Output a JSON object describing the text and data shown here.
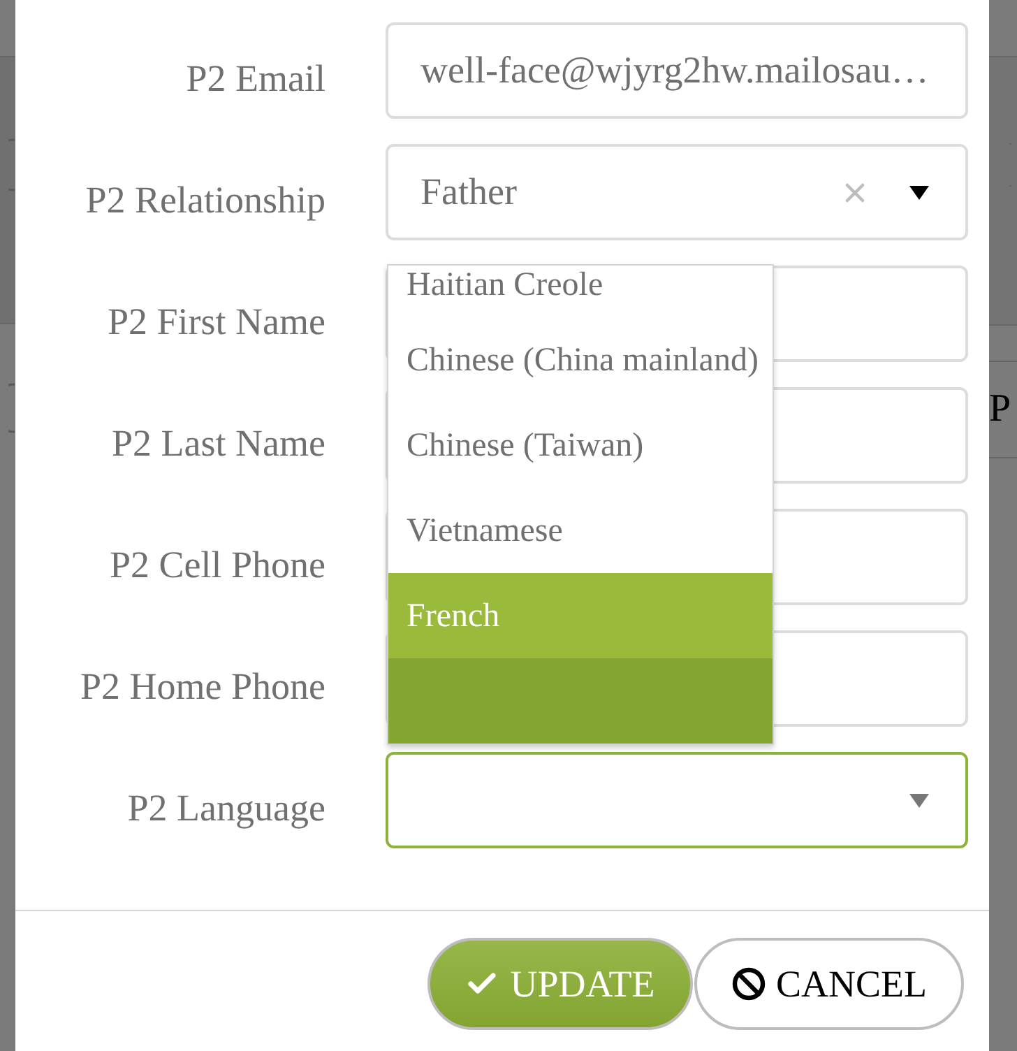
{
  "backdrop": {
    "edge_text": "P"
  },
  "form": {
    "fields": [
      {
        "label": "P2 Email",
        "kind": "text",
        "value": "well-face@wjyrg2hw.mailosau…",
        "focused": false
      },
      {
        "label": "P2 Relationship",
        "kind": "select",
        "value": "Father",
        "clearable": true,
        "open": false,
        "focused": false
      },
      {
        "label": "P2 First Name",
        "kind": "text",
        "focused": false
      },
      {
        "label": "P2 Last Name",
        "kind": "text",
        "focused": false
      },
      {
        "label": "P2 Cell Phone",
        "kind": "text",
        "focused": false
      },
      {
        "label": "P2 Home Phone",
        "kind": "text",
        "focused": false
      },
      {
        "label": "P2 Language",
        "kind": "select",
        "clearable": false,
        "open": true,
        "focused": true,
        "options": [
          {
            "label": "Haitian Creole",
            "selected": false,
            "hovered": false
          },
          {
            "label": "Chinese (China mainland)",
            "selected": false,
            "hovered": false
          },
          {
            "label": "Chinese (Taiwan)",
            "selected": false,
            "hovered": false
          },
          {
            "label": "Vietnamese",
            "selected": false,
            "hovered": false
          },
          {
            "label": "French",
            "selected": true,
            "hovered": false
          },
          {
            "selected": false,
            "hovered": true
          }
        ]
      }
    ]
  },
  "buttons": [
    {
      "label": "UPDATE",
      "kind": "primary"
    },
    {
      "label": "CANCEL",
      "kind": "secondary"
    }
  ]
}
